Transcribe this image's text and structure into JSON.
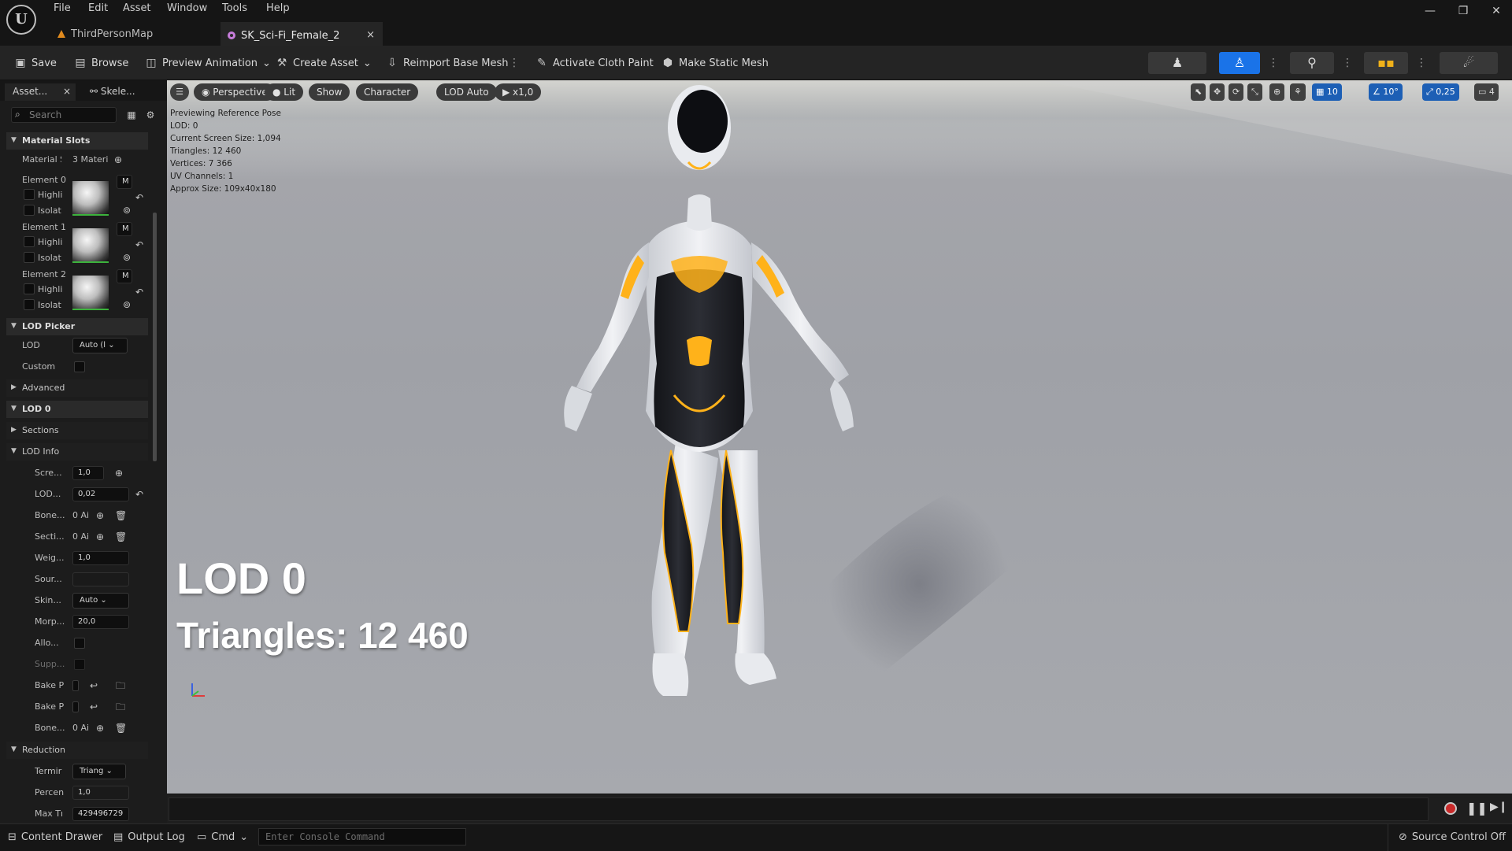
{
  "app": {
    "logo_text": "U"
  },
  "menu": [
    "File",
    "Edit",
    "Asset",
    "Window",
    "Tools",
    "Help"
  ],
  "window_controls": {
    "minimize": "—",
    "restore": "❐",
    "close": "✕"
  },
  "tabs": [
    {
      "label": "ThirdPersonMap",
      "active": false
    },
    {
      "label": "SK_Sci-Fi_Female_2",
      "active": true,
      "close": "×"
    }
  ],
  "toolbar": {
    "save": "Save",
    "browse": "Browse",
    "preview_animation": "Preview Animation",
    "create_asset": "Create Asset",
    "reimport": "Reimport Base Mesh",
    "cloth_paint": "Activate Cloth Paint",
    "make_static": "Make Static Mesh"
  },
  "left_panel": {
    "tabs": [
      "Asset...",
      "Skele..."
    ],
    "search_placeholder": "Search",
    "material_slots": {
      "header": "Material Slots",
      "slots_label": "Material S",
      "slots_value": "3 Materi",
      "elements": [
        {
          "label": "Element 0",
          "highlight": "Highli",
          "isolate": "Isolat",
          "m": "M"
        },
        {
          "label": "Element 1",
          "highlight": "Highli",
          "isolate": "Isolat",
          "m": "M"
        },
        {
          "label": "Element 2",
          "highlight": "Highli",
          "isolate": "Isolat",
          "m": "M"
        }
      ]
    },
    "lod_picker": {
      "header": "LOD Picker",
      "lod_label": "LOD",
      "lod_value": "Auto (l",
      "custom_label": "Custom"
    },
    "advanced": "Advanced",
    "lod0": "LOD 0",
    "sections": "Sections",
    "lod_info": {
      "header": "LOD Info",
      "rows": [
        {
          "label": "Scre...",
          "value": "1,0"
        },
        {
          "label": "LOD...",
          "value": "0,02"
        },
        {
          "label": "Bone...",
          "value": "0 Ai"
        },
        {
          "label": "Secti...",
          "value": "0 Ai"
        },
        {
          "label": "Weig...",
          "value": "1,0"
        },
        {
          "label": "Sour...",
          "value": ""
        },
        {
          "label": "Skin...",
          "value": "Auto"
        },
        {
          "label": "Morp...",
          "value": "20,0"
        },
        {
          "label": "Allo...",
          "value": ""
        },
        {
          "label": "Supp...",
          "value": ""
        },
        {
          "label": "Bake P",
          "value": ""
        },
        {
          "label": "Bake P",
          "value": ""
        },
        {
          "label": "Bone...",
          "value": "0 Ai"
        }
      ]
    },
    "reduction": {
      "header": "Reduction",
      "rows": [
        {
          "label": "Termir",
          "value": "Triang"
        },
        {
          "label": "Percen",
          "value": "1,0"
        },
        {
          "label": "Max Tı",
          "value": "429496729"
        }
      ]
    }
  },
  "viewport": {
    "menu_icon": "☰",
    "perspective": "Perspective",
    "lit": "Lit",
    "show": "Show",
    "character": "Character",
    "lod_auto": "LOD Auto",
    "playback": "x1,0",
    "right_controls": {
      "grid": "10",
      "angle": "10°",
      "scale": "0,25",
      "camera": "4"
    },
    "stats": [
      "Previewing Reference Pose",
      "LOD: 0",
      "Current Screen Size: 1,094",
      "Triangles: 12 460",
      "Vertices: 7 366",
      "UV Channels: 1",
      "Approx Size: 109x40x180"
    ],
    "overlay_lod": "LOD 0",
    "overlay_triangles": "Triangles: 12 460"
  },
  "statusbar": {
    "content_drawer": "Content Drawer",
    "output_log": "Output Log",
    "cmd": "Cmd",
    "console_placeholder": "Enter Console Command",
    "source_control": "Source Control Off"
  },
  "colors": {
    "accent_blue": "#1a73e8",
    "glow_orange": "#ffb21a",
    "suit_white": "#e6e8ec",
    "suit_black": "#1c1d22"
  }
}
